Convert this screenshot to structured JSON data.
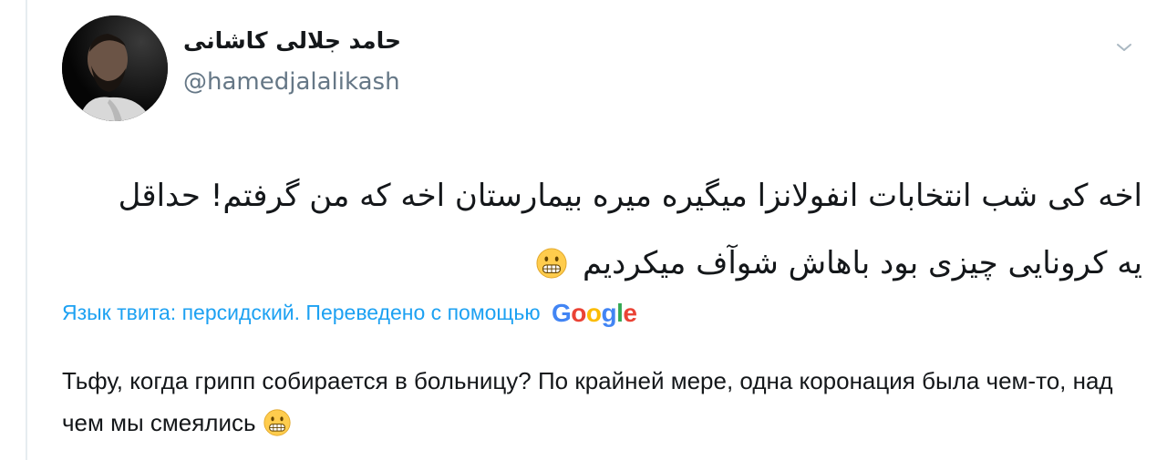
{
  "author": {
    "name": "حامد جلالی کاشانی",
    "handle": "@hamedjalalikash"
  },
  "tweet": {
    "original_line1": "اخه کی شب انتخابات انفولانزا میگیره میره بیمارستان اخه که من گرفتم! حداقل",
    "original_line2": "یه کرونایی چیزی بود باهاش شوآف میکردیم",
    "translation_label": "Язык твита: персидский. Переведено с помощью",
    "translation_provider": {
      "letters": [
        "G",
        "o",
        "o",
        "g",
        "l",
        "e"
      ],
      "colors": [
        "#4285F4",
        "#EA4335",
        "#FBBC05",
        "#4285F4",
        "#34A853",
        "#EA4335"
      ]
    },
    "translated_text": "Тьфу, когда грипп собирается в больницу? По крайней мере, одна коронация была чем-то, над чем мы смеялись",
    "emoji": "grimacing-face"
  },
  "colors": {
    "link": "#1da1f2",
    "secondary_text": "#657786",
    "primary_text": "#14171a"
  }
}
